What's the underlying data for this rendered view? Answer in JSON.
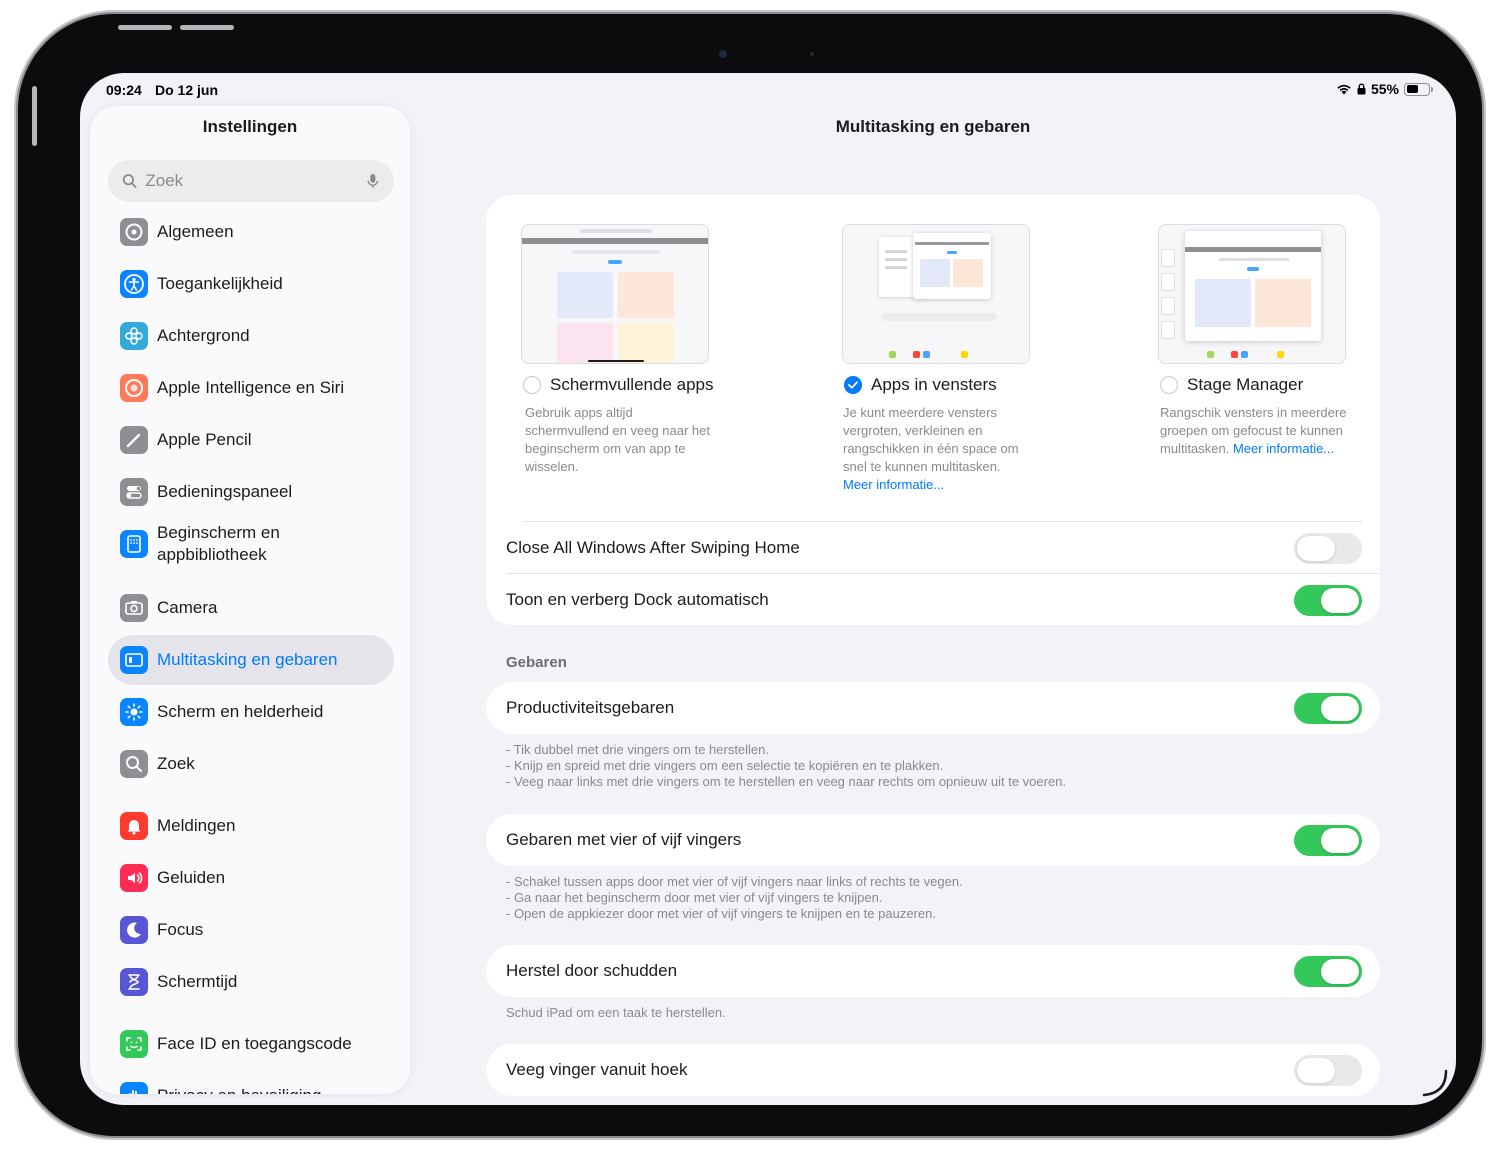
{
  "status_bar": {
    "time": "09:24",
    "date": "Do 12 jun",
    "battery_percent": "55%",
    "battery_level": 0.55
  },
  "sidebar": {
    "title": "Instellingen",
    "search_placeholder": "Zoek",
    "items": [
      {
        "label": "Algemeen",
        "icon": "gear-icon",
        "color": "#8e8e93"
      },
      {
        "label": "Toegankelijkheid",
        "icon": "accessibility-icon",
        "color": "#0a84ff"
      },
      {
        "label": "Achtergrond",
        "icon": "flower-icon",
        "color": "#34aadc"
      },
      {
        "label": "Apple Intelligence en Siri",
        "icon": "siri-icon",
        "color": "#ff7a59"
      },
      {
        "label": "Apple Pencil",
        "icon": "pencil-icon",
        "color": "#8e8e93"
      },
      {
        "label": "Bedieningspaneel",
        "icon": "toggles-icon",
        "color": "#8e8e93"
      },
      {
        "label": "Beginscherm en appbibliotheek",
        "icon": "home-screen-icon",
        "color": "#0a84ff"
      },
      {
        "label": "Camera",
        "icon": "camera-icon",
        "color": "#8e8e93"
      },
      {
        "label": "Multitasking en gebaren",
        "icon": "multitasking-icon",
        "color": "#0a84ff",
        "selected": true
      },
      {
        "label": "Scherm en helderheid",
        "icon": "sun-icon",
        "color": "#0a84ff"
      },
      {
        "label": "Zoek",
        "icon": "search-icon",
        "color": "#8e8e93"
      },
      {
        "label": "Meldingen",
        "icon": "bell-icon",
        "color": "#ff3b30"
      },
      {
        "label": "Geluiden",
        "icon": "speaker-icon",
        "color": "#ff2d55"
      },
      {
        "label": "Focus",
        "icon": "moon-icon",
        "color": "#5856d6"
      },
      {
        "label": "Schermtijd",
        "icon": "hourglass-icon",
        "color": "#5856d6"
      },
      {
        "label": "Face ID en toegangscode",
        "icon": "face-id-icon",
        "color": "#34c759"
      },
      {
        "label": "Privacy en beveiliging",
        "icon": "hand-icon",
        "color": "#0a84ff"
      }
    ]
  },
  "main": {
    "title": "Multitasking en gebaren",
    "modes": [
      {
        "label": "Schermvullende apps",
        "selected": false,
        "description": "Gebruik apps altijd schermvullend en veeg naar het beginscherm om van app te wisselen.",
        "link": ""
      },
      {
        "label": "Apps in vensters",
        "selected": true,
        "description": "Je kunt meerdere vensters vergroten, verkleinen en rangschikken in één space om snel te kunnen multitasken.",
        "link": "Meer informatie..."
      },
      {
        "label": "Stage Manager",
        "selected": false,
        "description": "Rangschik vensters in meerdere groepen om gefocust te kunnen multitasken.",
        "link": "Meer informatie..."
      }
    ],
    "close_all_windows": {
      "label": "Close All Windows After Swiping Home",
      "on": false
    },
    "dock_auto": {
      "label": "Toon en verberg Dock automatisch",
      "on": true
    },
    "gestures_header": "Gebaren",
    "productivity": {
      "label": "Productiviteitsgebaren",
      "on": true,
      "notes": [
        "- Tik dubbel met drie vingers om te herstellen.",
        "- Knijp en spreid met drie vingers om een selectie te kopiëren en te plakken.",
        "- Veeg naar links met drie vingers om te herstellen en veeg naar rechts om opnieuw uit te voeren."
      ]
    },
    "four_five": {
      "label": "Gebaren met vier of vijf vingers",
      "on": true,
      "notes": [
        "- Schakel tussen apps door met vier of vijf vingers naar links of rechts te vegen.",
        "- Ga naar het beginscherm door met vier of vijf vingers te knijpen.",
        "- Open de appkiezer door met vier of vijf vingers te knijpen en te pauzeren."
      ]
    },
    "shake": {
      "label": "Herstel door schudden",
      "on": true,
      "note": "Schud iPad om een taak te herstellen."
    },
    "corner_swipe": {
      "label": "Veeg vinger vanuit hoek",
      "on": false
    }
  }
}
